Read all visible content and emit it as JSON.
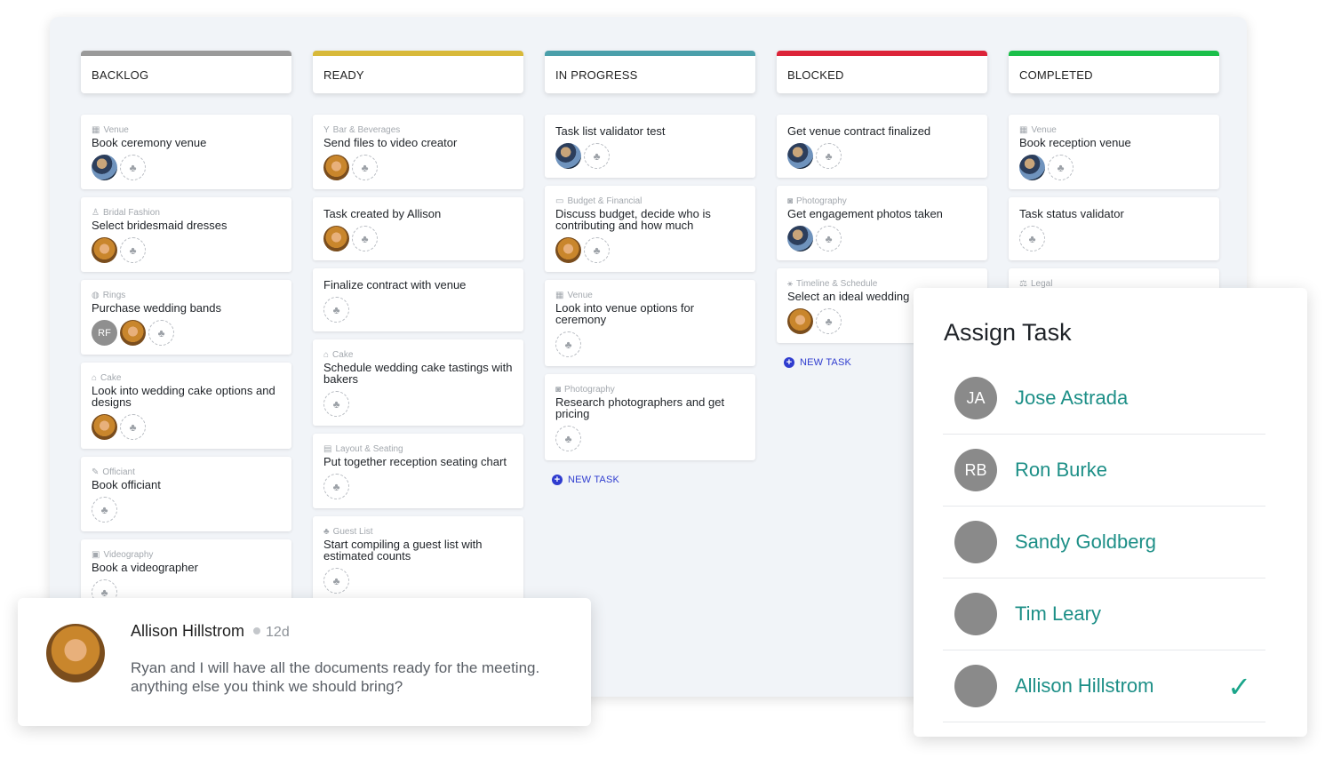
{
  "columns": [
    {
      "title": "BACKLOG",
      "color": "#9a9a9a",
      "cards": [
        {
          "category": "Venue",
          "icon": "building-icon",
          "title": "Book ceremony venue",
          "avatars": [
            "sandy"
          ]
        },
        {
          "category": "Bridal Fashion",
          "icon": "dress-icon",
          "title": "Select bridesmaid dresses",
          "avatars": [
            "allison"
          ]
        },
        {
          "category": "Rings",
          "icon": "ring-icon",
          "title": "Purchase wedding bands",
          "avatars": [
            "RF",
            "allison"
          ]
        },
        {
          "category": "Cake",
          "icon": "cake-icon",
          "title": "Look into wedding cake options and designs",
          "avatars": [
            "allison"
          ]
        },
        {
          "category": "Officiant",
          "icon": "pen-icon",
          "title": "Book officiant",
          "avatars": []
        },
        {
          "category": "Videography",
          "icon": "video-icon",
          "title": "Book a videographer",
          "avatars": []
        }
      ]
    },
    {
      "title": "READY",
      "color": "#d8b93a",
      "cards": [
        {
          "category": "Bar & Beverages",
          "icon": "glass-icon",
          "title": "Send files to video creator",
          "avatars": [
            "allison"
          ]
        },
        {
          "category": "",
          "icon": "",
          "title": "Task created by Allison",
          "avatars": [
            "allison"
          ]
        },
        {
          "category": "",
          "icon": "",
          "title": "Finalize contract with venue",
          "avatars": []
        },
        {
          "category": "Cake",
          "icon": "cake-icon",
          "title": "Schedule wedding cake tastings with bakers",
          "avatars": []
        },
        {
          "category": "Layout & Seating",
          "icon": "layout-icon",
          "title": "Put together reception seating chart",
          "avatars": []
        },
        {
          "category": "Guest List",
          "icon": "guests-icon",
          "title": "Start compiling a guest list with estimated counts",
          "avatars": []
        }
      ]
    },
    {
      "title": "IN PROGRESS",
      "color": "#4a9faa",
      "cards": [
        {
          "category": "",
          "icon": "",
          "title": "Task list validator test",
          "avatars": [
            "sandy"
          ]
        },
        {
          "category": "Budget & Financial",
          "icon": "money-icon",
          "title": "Discuss budget, decide who is contributing and how much",
          "avatars": [
            "allison"
          ]
        },
        {
          "category": "Venue",
          "icon": "building-icon",
          "title": "Look into venue options for ceremony",
          "avatars": []
        },
        {
          "category": "Photography",
          "icon": "camera-icon",
          "title": "Research photographers and get pricing",
          "avatars": []
        }
      ],
      "new_task": "NEW TASK"
    },
    {
      "title": "BLOCKED",
      "color": "#dc2439",
      "cards": [
        {
          "category": "",
          "icon": "",
          "title": "Get venue contract finalized",
          "avatars": [
            "sandy"
          ]
        },
        {
          "category": "Photography",
          "icon": "camera-icon",
          "title": "Get engagement photos taken",
          "avatars": [
            "sandy"
          ]
        },
        {
          "category": "Timeline & Schedule",
          "icon": "timeline-icon",
          "title": "Select an ideal wedding",
          "avatars": [
            "allison"
          ]
        }
      ],
      "new_task": "NEW TASK"
    },
    {
      "title": "COMPLETED",
      "color": "#1bbf4a",
      "cards": [
        {
          "category": "Venue",
          "icon": "building-icon",
          "title": "Book reception venue",
          "avatars": [
            "sandy"
          ]
        },
        {
          "category": "",
          "icon": "",
          "title": "Task status validator",
          "avatars": []
        },
        {
          "category": "Legal",
          "icon": "legal-icon",
          "title": "",
          "avatars": []
        }
      ]
    }
  ],
  "comment": {
    "author": "Allison Hillstrom",
    "time": "12d",
    "text": "Ryan and I will have all the documents ready for the meeting. anything else you think we should bring?"
  },
  "assign": {
    "title": "Assign Task",
    "people": [
      {
        "initials": "JA",
        "name": "Jose Astrada",
        "avatar": "initials",
        "selected": false
      },
      {
        "initials": "RB",
        "name": "Ron Burke",
        "avatar": "initials",
        "selected": false
      },
      {
        "initials": "",
        "name": "Sandy Goldberg",
        "avatar": "sandy",
        "selected": false
      },
      {
        "initials": "",
        "name": "Tim Leary",
        "avatar": "tim",
        "selected": false
      },
      {
        "initials": "",
        "name": "Allison Hillstrom",
        "avatar": "allison",
        "selected": true
      }
    ],
    "check": "✓"
  }
}
